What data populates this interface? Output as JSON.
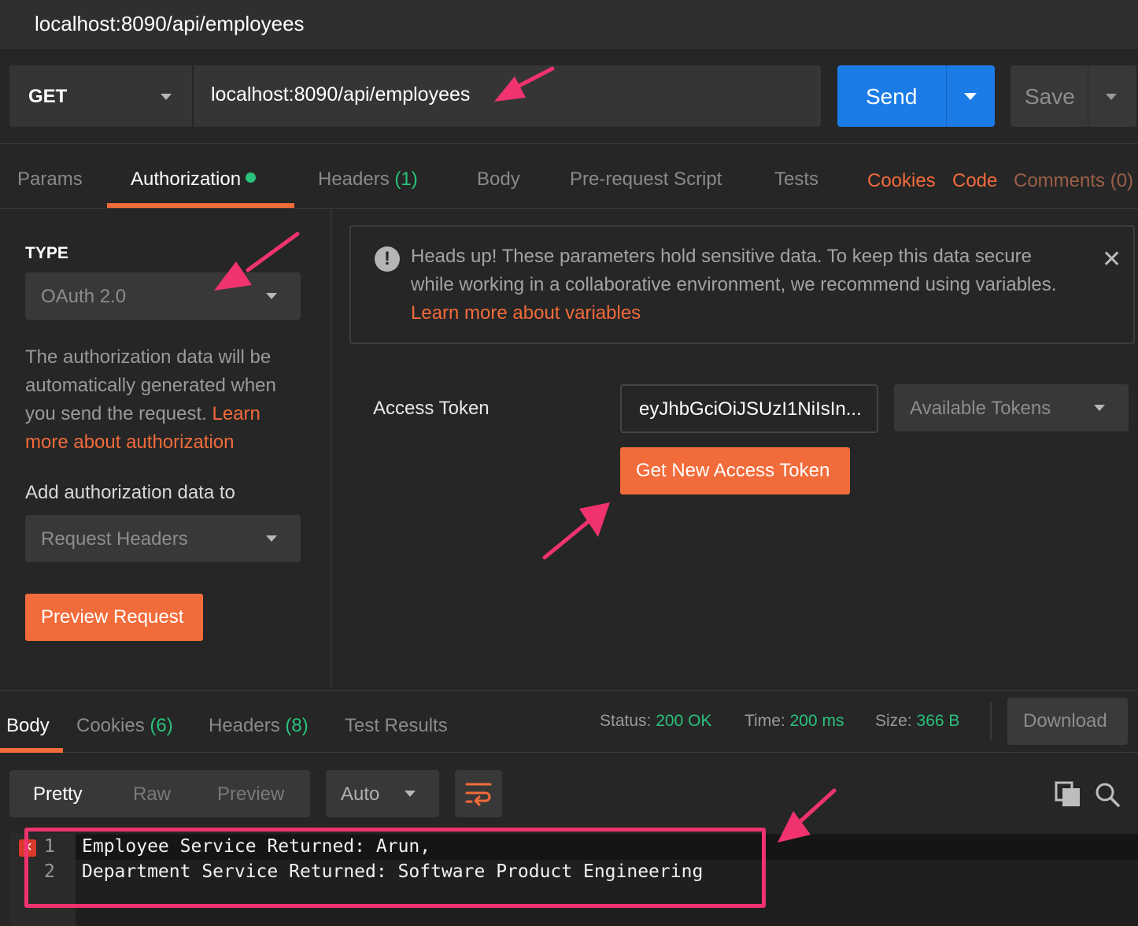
{
  "window": {
    "title": "localhost:8090/api/employees"
  },
  "request": {
    "method": "GET",
    "url": "localhost:8090/api/employees",
    "send_label": "Send",
    "save_label": "Save"
  },
  "request_tabs": {
    "params": "Params",
    "authorization": "Authorization",
    "headers": "Headers",
    "headers_count": "(1)",
    "body": "Body",
    "prerequest": "Pre-request Script",
    "tests": "Tests",
    "cookies": "Cookies",
    "code": "Code",
    "comments": "Comments (0)"
  },
  "auth": {
    "type_label": "TYPE",
    "type_value": "OAuth 2.0",
    "description": "The authorization data will be automatically generated when you send the request.",
    "description_link": "Learn more about authorization",
    "add_to_label": "Add authorization data to",
    "add_to_value": "Request Headers",
    "preview_button": "Preview Request"
  },
  "notice": {
    "text": "Heads up! These parameters hold sensitive data. To keep this data secure while working in a collaborative environment, we recommend using variables.",
    "link": "Learn more about variables",
    "close": "✕",
    "icon": "!"
  },
  "token": {
    "label": "Access Token",
    "value": "eyJhbGciOiJSUzI1NiIsIn...",
    "available_tokens": "Available Tokens",
    "get_new_button": "Get New Access Token"
  },
  "response_tabs": {
    "body": "Body",
    "cookies": "Cookies",
    "cookies_count": "(6)",
    "headers": "Headers",
    "headers_count": "(8)",
    "test_results": "Test Results"
  },
  "response_status": {
    "status_label": "Status:",
    "status_value": "200 OK",
    "time_label": "Time:",
    "time_value": "200 ms",
    "size_label": "Size:",
    "size_value": "366 B",
    "download": "Download"
  },
  "response_view": {
    "pretty": "Pretty",
    "raw": "Raw",
    "preview": "Preview",
    "format": "Auto"
  },
  "response_body": {
    "lines": [
      {
        "num": "1",
        "text": "Employee Service Returned: Arun,"
      },
      {
        "num": "2",
        "text": "Department Service Returned: Software Product Engineering"
      }
    ],
    "error_marker": "✕"
  },
  "colors": {
    "accent_orange": "#f26b3a",
    "send_blue": "#1b7ce8",
    "status_green": "#2ac27a",
    "annotation_pink": "#f0336e"
  }
}
